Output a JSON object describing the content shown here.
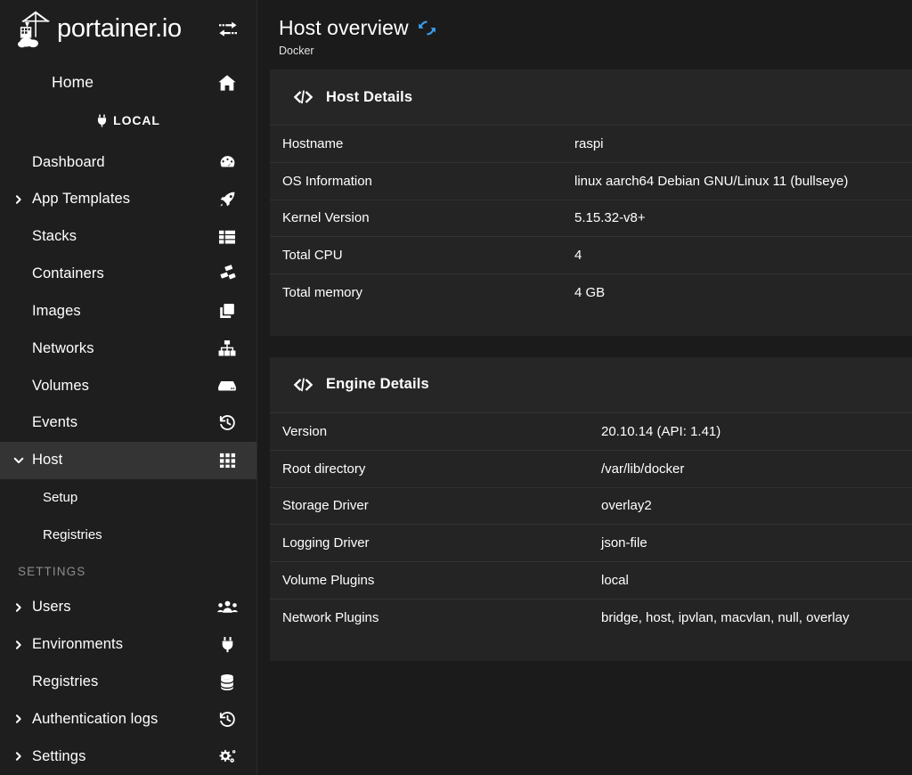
{
  "brand": {
    "name": "portainer.io",
    "logo_icon": "portainer-crane-logo",
    "toggle_icon": "exchange-arrows-icon"
  },
  "sidebar": {
    "home": {
      "label": "Home",
      "icon": "home-icon"
    },
    "environment": {
      "label": "LOCAL",
      "icon": "plug-icon"
    },
    "items": [
      {
        "label": "Dashboard",
        "icon": "dashboard-gauge-icon",
        "chevron": "",
        "active": false
      },
      {
        "label": "App Templates",
        "icon": "rocket-icon",
        "chevron": "right",
        "active": false
      },
      {
        "label": "Stacks",
        "icon": "layers-grid-icon",
        "chevron": "",
        "active": false
      },
      {
        "label": "Containers",
        "icon": "containers-icon",
        "chevron": "",
        "active": false
      },
      {
        "label": "Images",
        "icon": "copy-images-icon",
        "chevron": "",
        "active": false
      },
      {
        "label": "Networks",
        "icon": "network-sitemap-icon",
        "chevron": "",
        "active": false
      },
      {
        "label": "Volumes",
        "icon": "volumes-hdd-icon",
        "chevron": "",
        "active": false
      },
      {
        "label": "Events",
        "icon": "history-clock-icon",
        "chevron": "",
        "active": false
      },
      {
        "label": "Host",
        "icon": "grid-squares-icon",
        "chevron": "down",
        "active": true
      }
    ],
    "host_subitems": [
      {
        "label": "Setup"
      },
      {
        "label": "Registries"
      }
    ],
    "settings_section_title": "SETTINGS",
    "settings_items": [
      {
        "label": "Users",
        "icon": "users-group-icon",
        "chevron": "right"
      },
      {
        "label": "Environments",
        "icon": "plug-icon",
        "chevron": "right"
      },
      {
        "label": "Registries",
        "icon": "database-stack-icon",
        "chevron": ""
      },
      {
        "label": "Authentication logs",
        "icon": "history-clock-icon",
        "chevron": "right"
      },
      {
        "label": "Settings",
        "icon": "cogs-icon",
        "chevron": "right"
      }
    ]
  },
  "page": {
    "title": "Host overview",
    "subtitle": "Docker",
    "refresh_icon": "sync-refresh-icon",
    "refresh_color": "#3b9ff0"
  },
  "panels": [
    {
      "title": "Host Details",
      "icon": "code-brackets-icon",
      "rows": [
        {
          "key": "Hostname",
          "value": "raspi"
        },
        {
          "key": "OS Information",
          "value": "linux aarch64 Debian GNU/Linux 11 (bullseye)"
        },
        {
          "key": "Kernel Version",
          "value": "5.15.32-v8+"
        },
        {
          "key": "Total CPU",
          "value": "4"
        },
        {
          "key": "Total memory",
          "value": "4 GB"
        }
      ]
    },
    {
      "title": "Engine Details",
      "icon": "code-brackets-icon",
      "rows": [
        {
          "key": "Version",
          "value": "20.10.14 (API: 1.41)"
        },
        {
          "key": "Root directory",
          "value": "/var/lib/docker"
        },
        {
          "key": "Storage Driver",
          "value": "overlay2"
        },
        {
          "key": "Logging Driver",
          "value": "json-file"
        },
        {
          "key": "Volume Plugins",
          "value": "local"
        },
        {
          "key": "Network Plugins",
          "value": "bridge, host, ipvlan, macvlan, null, overlay"
        }
      ]
    }
  ],
  "colors": {
    "sidebar_bg": "#1e1e1e",
    "main_bg": "#1b1b1b",
    "panel_bg": "#242424",
    "panel_head_bg": "#262626",
    "active_item_bg": "#343434",
    "divider": "#323232",
    "accent_blue": "#3b9ff0",
    "muted_text": "#8c8c8c"
  }
}
